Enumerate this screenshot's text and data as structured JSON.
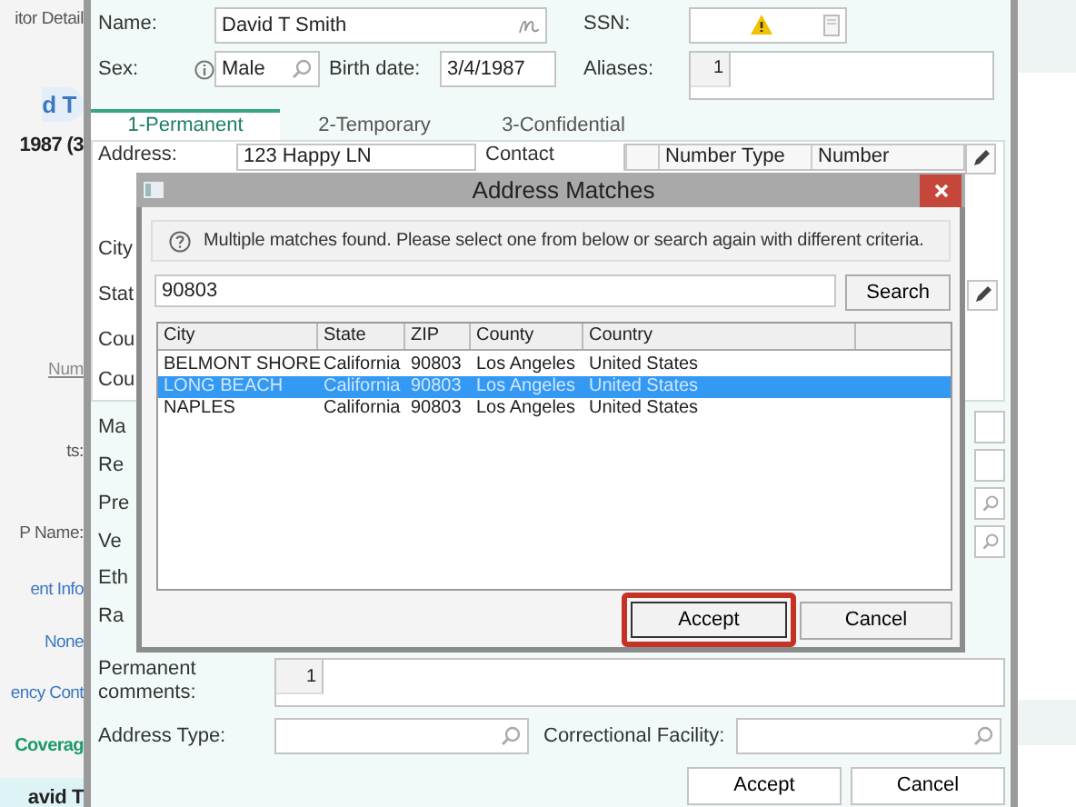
{
  "sidebar": {
    "items": [
      {
        "text": "itor Detail",
        "kind": "caption"
      },
      {
        "text": "d T",
        "kind": "bubble"
      },
      {
        "text": "1987 (3",
        "kind": "bold"
      },
      {
        "text": "Num",
        "kind": "underlined"
      },
      {
        "text": "ts:",
        "kind": "label"
      },
      {
        "text": "P Name:",
        "kind": "label"
      },
      {
        "text": "ent Info",
        "kind": "link"
      },
      {
        "text": "None",
        "kind": "link"
      },
      {
        "text": "ency Cont",
        "kind": "link"
      },
      {
        "text": "Coverag",
        "kind": "heading"
      },
      {
        "text": "avid T",
        "kind": "highlight"
      }
    ]
  },
  "form": {
    "name": {
      "label": "Name:",
      "value": "David T Smith"
    },
    "ssn": {
      "label": "SSN:"
    },
    "sex": {
      "label": "Sex:",
      "value": "Male"
    },
    "birth_date": {
      "label": "Birth date:",
      "value": "3/4/1987"
    },
    "aliases": {
      "label": "Aliases:",
      "count": "1"
    },
    "tabs": [
      {
        "label": "1-Permanent",
        "selected": true
      },
      {
        "label": "2-Temporary",
        "selected": false
      },
      {
        "label": "3-Confidential",
        "selected": false
      }
    ],
    "address": {
      "label": "Address:",
      "value": "123 Happy LN"
    },
    "contact": {
      "label": "Contact",
      "columns": [
        "Number Type",
        "Number"
      ]
    },
    "covered_labels": [
      "City",
      "Stat",
      "Cou",
      "Cou"
    ],
    "lower_labels": [
      {
        "text": "Ma",
        "kind": "field"
      },
      {
        "text": "Re",
        "kind": "field"
      },
      {
        "text": "Pre",
        "kind": "lookup"
      },
      {
        "text": "Ve",
        "kind": "lookup"
      },
      {
        "text": "Eth",
        "kind": "none"
      },
      {
        "text": "Ra",
        "kind": "none"
      }
    ],
    "comments": {
      "label": "Permanent comments:",
      "count": "1"
    },
    "address_type": {
      "label": "Address Type:"
    },
    "correctional_facility": {
      "label": "Correctional Facility:"
    },
    "buttons": [
      "Accept",
      "Cancel"
    ]
  },
  "dialog": {
    "title": "Address Matches",
    "message": "Multiple matches found. Please select one from below or search again with different criteria.",
    "search_value": "90803",
    "search_button": "Search",
    "columns": [
      "City",
      "State",
      "ZIP",
      "County",
      "Country"
    ],
    "rows": [
      {
        "cells": [
          "BELMONT SHORE",
          "California",
          "90803",
          "Los Angeles",
          "United States"
        ],
        "selected": false
      },
      {
        "cells": [
          "LONG BEACH",
          "California",
          "90803",
          "Los Angeles",
          "United States"
        ],
        "selected": true
      },
      {
        "cells": [
          "NAPLES",
          "California",
          "90803",
          "Los Angeles",
          "United States"
        ],
        "selected": false
      }
    ],
    "buttons": [
      {
        "label": "Accept",
        "highlighted": true
      },
      {
        "label": "Cancel",
        "highlighted": false
      }
    ]
  }
}
